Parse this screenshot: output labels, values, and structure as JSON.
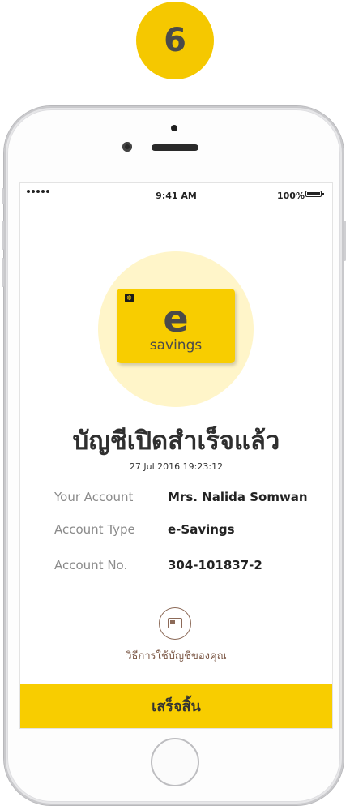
{
  "step": {
    "number": "6"
  },
  "status_bar": {
    "signal_dots": 5,
    "time": "9:41 AM",
    "battery": "100%"
  },
  "card": {
    "letter": "e",
    "word": "savings",
    "logo_glyph": "☸"
  },
  "title": "บัญชีเปิดสำเร็จแล้ว",
  "timestamp": "27 Jul 2016 19:23:12",
  "details": [
    {
      "label": "Your Account",
      "value": "Mrs. Nalida Somwan"
    },
    {
      "label": "Account Type",
      "value": "e-Savings"
    },
    {
      "label": "Account No.",
      "value": "304-101837-2"
    }
  ],
  "guide": {
    "label": "วิธีการใช้บัญชีของคุณ",
    "icon": "card-icon"
  },
  "finish_button": {
    "label": "เสร็จสิ้น"
  },
  "colors": {
    "accent": "#f8cd00",
    "halo": "#fff5c9",
    "guide": "#8c6a58"
  }
}
